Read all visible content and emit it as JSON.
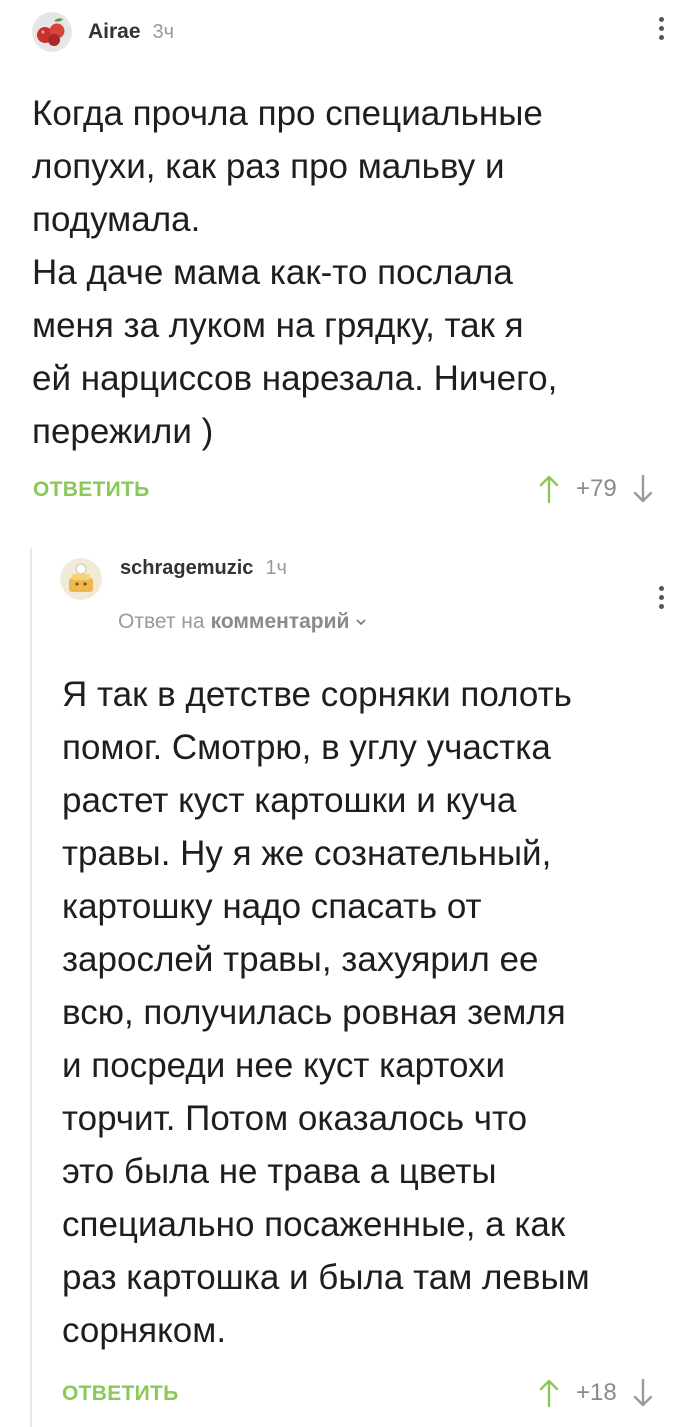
{
  "comments": [
    {
      "author": "Airae",
      "time": "3ч",
      "text": "Когда прочла про специальные\nлопухи, как раз про мальву и\nподумала.\nНа даче мама как-то послала\nменя за луком на грядку, так я\nей нарциссов нарезала. Ничего,\nпережили )",
      "reply_label": "ОТВЕТИТЬ",
      "score": "+79"
    },
    {
      "author": "schragemuzic",
      "time": "1ч",
      "reply_prefix": "Ответ на",
      "reply_link": "комментарий",
      "text": "Я так в детстве сорняки полоть\nпомог. Смотрю, в углу участка\nрастет куст картошки и куча\nтравы. Ну я же сознательный,\nкартошку надо спасать от\nзарослей травы, захуярил ее\nвсю, получилась ровная земля\nи посреди нее куст картохи\nторчит. Потом оказалось что\nэто была не трава а цветы\nспециально посаженные, а как\nраз картошка и была там левым\nсорняком.",
      "reply_label": "ОТВЕТИТЬ",
      "score": "+18"
    }
  ],
  "icons": {
    "upvote": "arrow-up-icon",
    "downvote": "arrow-down-icon",
    "menu": "more-vertical-icon",
    "chevron": "chevron-down-icon"
  },
  "colors": {
    "reply_green": "#8ac858",
    "meta_gray": "#9a9a9a"
  }
}
